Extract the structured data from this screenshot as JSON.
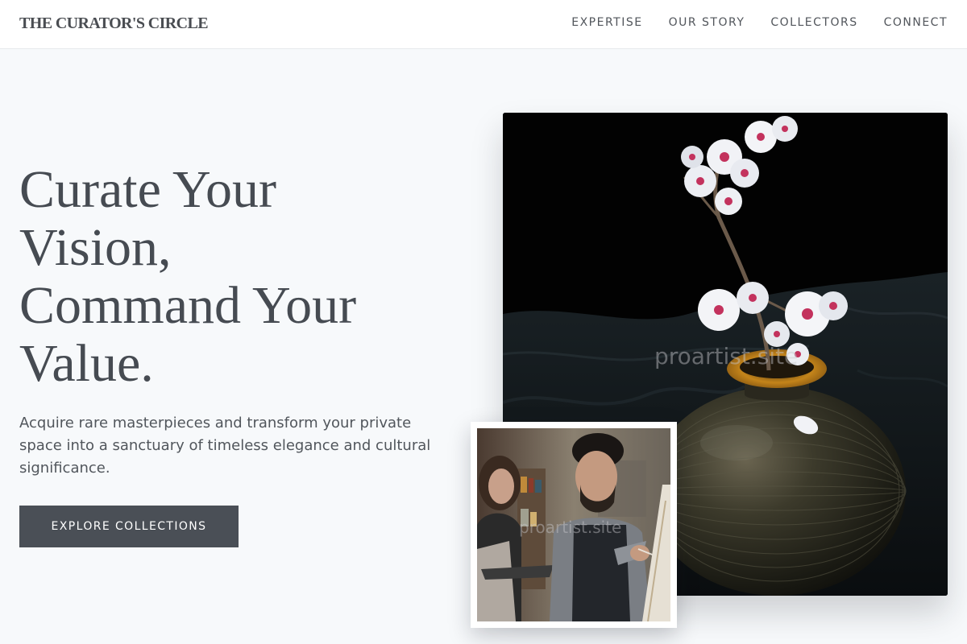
{
  "header": {
    "brand": "THE CURATOR'S CIRCLE",
    "nav": [
      {
        "label": "EXPERTISE"
      },
      {
        "label": "OUR STORY"
      },
      {
        "label": "COLLECTORS"
      },
      {
        "label": "CONNECT"
      }
    ]
  },
  "hero": {
    "title_lines": [
      "Curate Your",
      "Vision,",
      "Command Your",
      "Value."
    ],
    "subtitle": "Acquire rare masterpieces and transform your private space into a sanctuary of timeless elegance and cultural significance.",
    "cta_label": "EXPLORE COLLECTIONS"
  },
  "images": {
    "main_watermark": "proartist.site",
    "secondary_watermark": "proartist.site"
  },
  "colors": {
    "page_bg": "#f7f9fb",
    "header_bg": "#ffffff",
    "text_primary": "#464b52",
    "button_bg": "#4a4f56",
    "button_text": "#ffffff"
  }
}
